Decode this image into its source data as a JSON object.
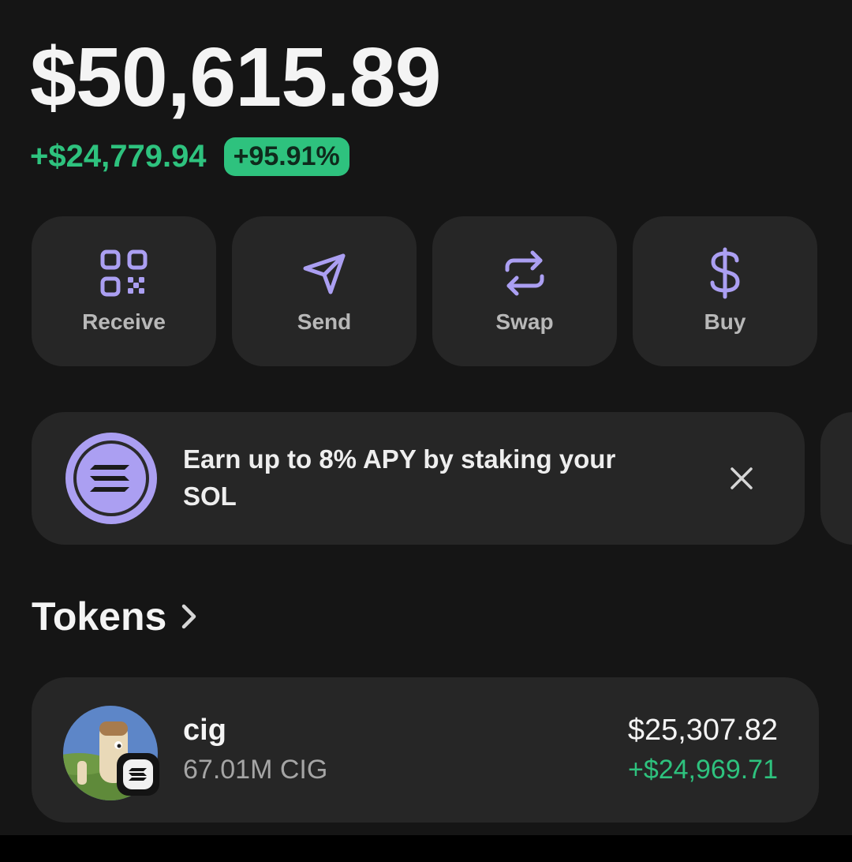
{
  "portfolio": {
    "balance": "$50,615.89",
    "change_amount": "+$24,779.94",
    "change_percent": "+95.91%"
  },
  "actions": [
    {
      "label": "Receive",
      "icon": "qr-code-icon"
    },
    {
      "label": "Send",
      "icon": "send-icon"
    },
    {
      "label": "Swap",
      "icon": "swap-icon"
    },
    {
      "label": "Buy",
      "icon": "dollar-icon"
    }
  ],
  "promo": {
    "text": "Earn up to 8% APY by staking your SOL",
    "icon": "solana-icon",
    "close_icon": "close-icon"
  },
  "tokens_section": {
    "title": "Tokens",
    "chevron_icon": "chevron-right-icon"
  },
  "tokens": [
    {
      "name": "cig",
      "amount": "67.01M CIG",
      "value": "$25,307.82",
      "change": "+$24,969.71",
      "chain_badge_icon": "solana-icon"
    }
  ],
  "colors": {
    "background": "#151515",
    "card": "#262626",
    "accent_purple": "#ab9ff2",
    "positive_green": "#2ec27e"
  }
}
